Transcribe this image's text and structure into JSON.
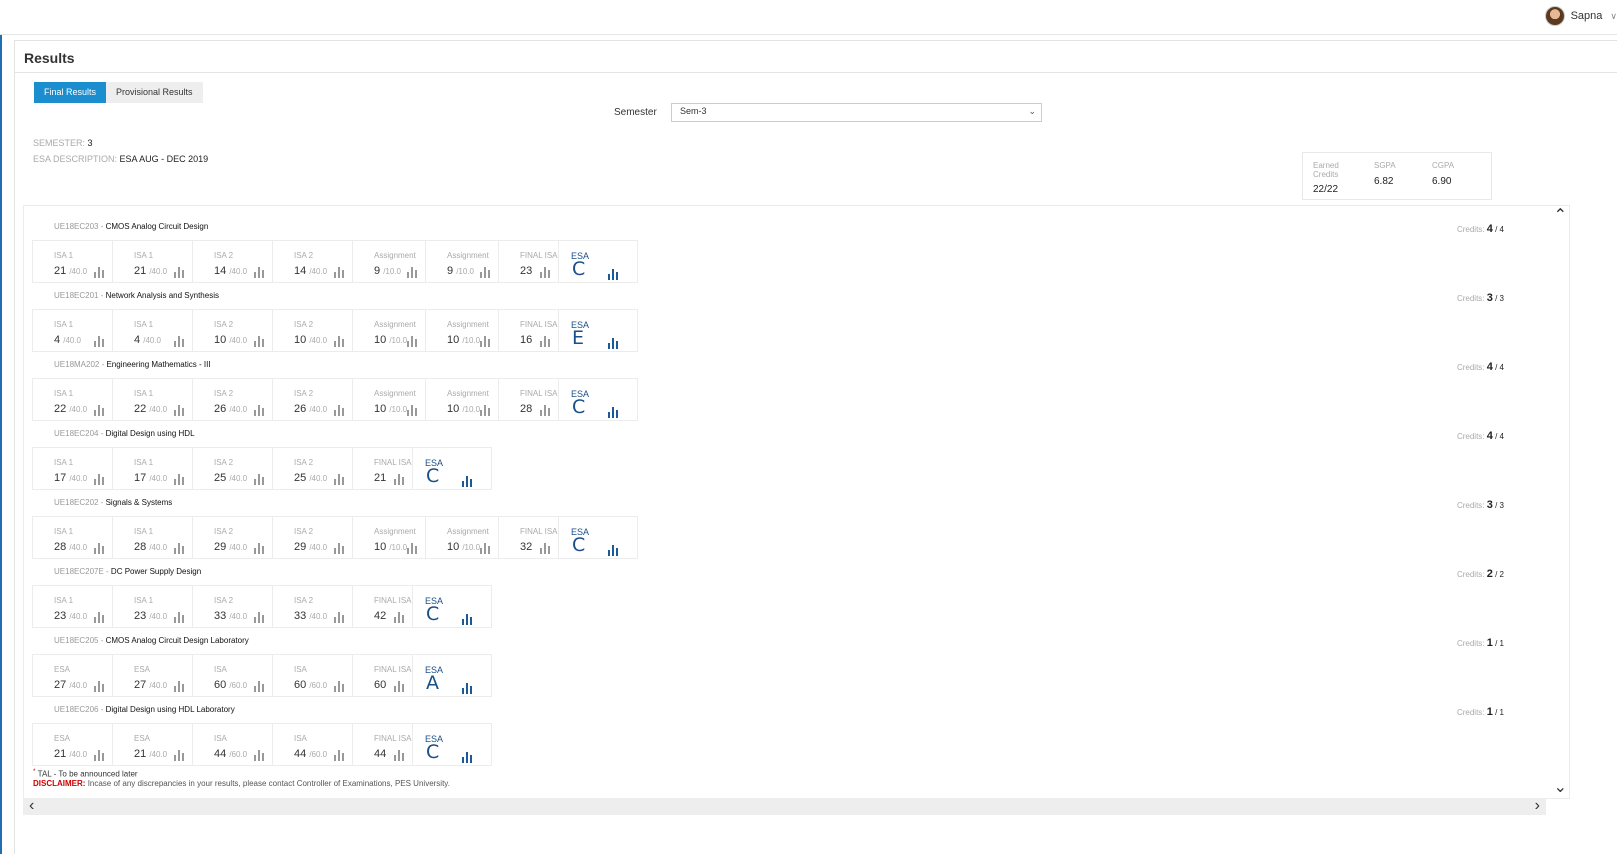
{
  "header": {
    "user_name": "Sapna"
  },
  "panel": {
    "title": "Results"
  },
  "tabs": [
    {
      "label": "Final Results",
      "active": true
    },
    {
      "label": "Provisional Results",
      "active": false
    }
  ],
  "semester_filter": {
    "label": "Semester",
    "value": "Sem-3"
  },
  "meta": {
    "semester_label": "SEMESTER:",
    "semester_value": "3",
    "esa_label": "ESA DESCRIPTION:",
    "esa_value": "ESA AUG - DEC 2019"
  },
  "summary": {
    "earned_credits_label": "Earned Credits",
    "earned_credits": "22/22",
    "sgpa_label": "SGPA",
    "sgpa": "6.82",
    "cgpa_label": "CGPA",
    "cgpa": "6.90"
  },
  "courses": [
    {
      "code": "UE18EC203",
      "name": "CMOS Analog Circuit Design",
      "credits": "4",
      "credits_total": "4",
      "items": [
        {
          "label": "ISA 1",
          "score": "21",
          "max": "40.0"
        },
        {
          "label": "ISA 1",
          "score": "21",
          "max": "40.0"
        },
        {
          "label": "ISA 2",
          "score": "14",
          "max": "40.0"
        },
        {
          "label": "ISA 2",
          "score": "14",
          "max": "40.0"
        },
        {
          "label": "Assignment",
          "score": "9",
          "max": "10.0"
        },
        {
          "label": "Assignment",
          "score": "9",
          "max": "10.0"
        },
        {
          "label": "FINAL ISA",
          "score": "23",
          "max": ""
        }
      ],
      "esa_label": "ESA",
      "grade": "C"
    },
    {
      "code": "UE18EC201",
      "name": "Network Analysis and Synthesis",
      "credits": "3",
      "credits_total": "3",
      "items": [
        {
          "label": "ISA 1",
          "score": "4",
          "max": "40.0"
        },
        {
          "label": "ISA 1",
          "score": "4",
          "max": "40.0"
        },
        {
          "label": "ISA 2",
          "score": "10",
          "max": "40.0"
        },
        {
          "label": "ISA 2",
          "score": "10",
          "max": "40.0"
        },
        {
          "label": "Assignment",
          "score": "10",
          "max": "10.0"
        },
        {
          "label": "Assignment",
          "score": "10",
          "max": "10.0"
        },
        {
          "label": "FINAL ISA",
          "score": "16",
          "max": ""
        }
      ],
      "esa_label": "ESA",
      "grade": "E"
    },
    {
      "code": "UE18MA202",
      "name": "Engineering Mathematics - III",
      "credits": "4",
      "credits_total": "4",
      "items": [
        {
          "label": "ISA 1",
          "score": "22",
          "max": "40.0"
        },
        {
          "label": "ISA 1",
          "score": "22",
          "max": "40.0"
        },
        {
          "label": "ISA 2",
          "score": "26",
          "max": "40.0"
        },
        {
          "label": "ISA 2",
          "score": "26",
          "max": "40.0"
        },
        {
          "label": "Assignment",
          "score": "10",
          "max": "10.0"
        },
        {
          "label": "Assignment",
          "score": "10",
          "max": "10.0"
        },
        {
          "label": "FINAL ISA",
          "score": "28",
          "max": ""
        }
      ],
      "esa_label": "ESA",
      "grade": "C"
    },
    {
      "code": "UE18EC204",
      "name": "Digital Design using HDL",
      "credits": "4",
      "credits_total": "4",
      "items": [
        {
          "label": "ISA 1",
          "score": "17",
          "max": "40.0"
        },
        {
          "label": "ISA 1",
          "score": "17",
          "max": "40.0"
        },
        {
          "label": "ISA 2",
          "score": "25",
          "max": "40.0"
        },
        {
          "label": "ISA 2",
          "score": "25",
          "max": "40.0"
        },
        {
          "label": "FINAL ISA",
          "score": "21",
          "max": ""
        }
      ],
      "esa_label": "ESA",
      "grade": "C"
    },
    {
      "code": "UE18EC202",
      "name": "Signals & Systems",
      "credits": "3",
      "credits_total": "3",
      "items": [
        {
          "label": "ISA 1",
          "score": "28",
          "max": "40.0"
        },
        {
          "label": "ISA 1",
          "score": "28",
          "max": "40.0"
        },
        {
          "label": "ISA 2",
          "score": "29",
          "max": "40.0"
        },
        {
          "label": "ISA 2",
          "score": "29",
          "max": "40.0"
        },
        {
          "label": "Assignment",
          "score": "10",
          "max": "10.0"
        },
        {
          "label": "Assignment",
          "score": "10",
          "max": "10.0"
        },
        {
          "label": "FINAL ISA",
          "score": "32",
          "max": ""
        }
      ],
      "esa_label": "ESA",
      "grade": "C"
    },
    {
      "code": "UE18EC207E",
      "name": "DC Power Supply Design",
      "credits": "2",
      "credits_total": "2",
      "items": [
        {
          "label": "ISA 1",
          "score": "23",
          "max": "40.0"
        },
        {
          "label": "ISA 1",
          "score": "23",
          "max": "40.0"
        },
        {
          "label": "ISA 2",
          "score": "33",
          "max": "40.0"
        },
        {
          "label": "ISA 2",
          "score": "33",
          "max": "40.0"
        },
        {
          "label": "FINAL ISA",
          "score": "42",
          "max": ""
        }
      ],
      "esa_label": "ESA",
      "grade": "C"
    },
    {
      "code": "UE18EC205",
      "name": "CMOS Analog Circuit Design Laboratory",
      "credits": "1",
      "credits_total": "1",
      "items": [
        {
          "label": "ESA",
          "score": "27",
          "max": "40.0"
        },
        {
          "label": "ESA",
          "score": "27",
          "max": "40.0"
        },
        {
          "label": "ISA",
          "score": "60",
          "max": "60.0"
        },
        {
          "label": "ISA",
          "score": "60",
          "max": "60.0"
        },
        {
          "label": "FINAL ISA",
          "score": "60",
          "max": ""
        }
      ],
      "esa_label": "ESA",
      "grade": "A"
    },
    {
      "code": "UE18EC206",
      "name": "Digital Design using HDL Laboratory",
      "credits": "1",
      "credits_total": "1",
      "items": [
        {
          "label": "ESA",
          "score": "21",
          "max": "40.0"
        },
        {
          "label": "ESA",
          "score": "21",
          "max": "40.0"
        },
        {
          "label": "ISA",
          "score": "44",
          "max": "60.0"
        },
        {
          "label": "ISA",
          "score": "44",
          "max": "60.0"
        },
        {
          "label": "FINAL ISA",
          "score": "44",
          "max": ""
        }
      ],
      "esa_label": "ESA",
      "grade": "C"
    }
  ],
  "credits_label": "Credits:",
  "notes": {
    "tal_marker": "*",
    "tal": "TAL - To be announced later",
    "disclaimer_label": "DISCLAIMER:",
    "disclaimer": "Incase of any discrepancies in your results, please contact Controller of Examinations, PES University."
  },
  "icons": [
    "user-avatar",
    "chevron-down-icon",
    "bar-chart-icon",
    "chevron-up-icon",
    "chevron-left-icon",
    "chevron-right-icon"
  ],
  "colors": {
    "accent": "#1b8ed0",
    "grade": "#1a4f87",
    "disclaimer": "#cc0000",
    "left_accent": "#1f6fb2"
  }
}
